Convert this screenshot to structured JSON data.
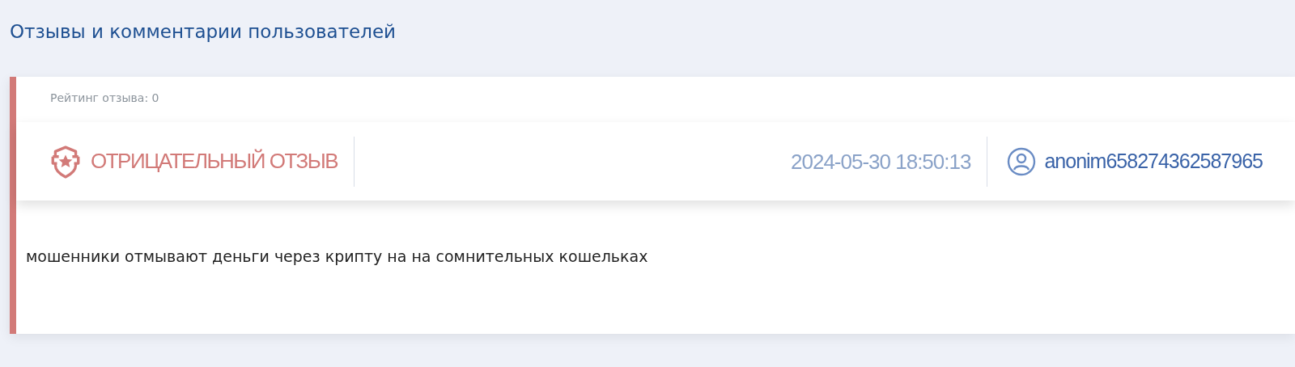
{
  "page_title": "Отзывы и комментарии пользователей",
  "review": {
    "kind": "negative",
    "rating": "Рейтинг отзыва: 0",
    "type_label": "ОТРИЦАТЕЛЬНЫЙ ОТЗЫВ",
    "datetime": "2024-05-30 18:50:13",
    "author": "anonim658274362587965",
    "text": "мошенники отмывают деньги через крипту на на сомнительных кошельках"
  }
}
